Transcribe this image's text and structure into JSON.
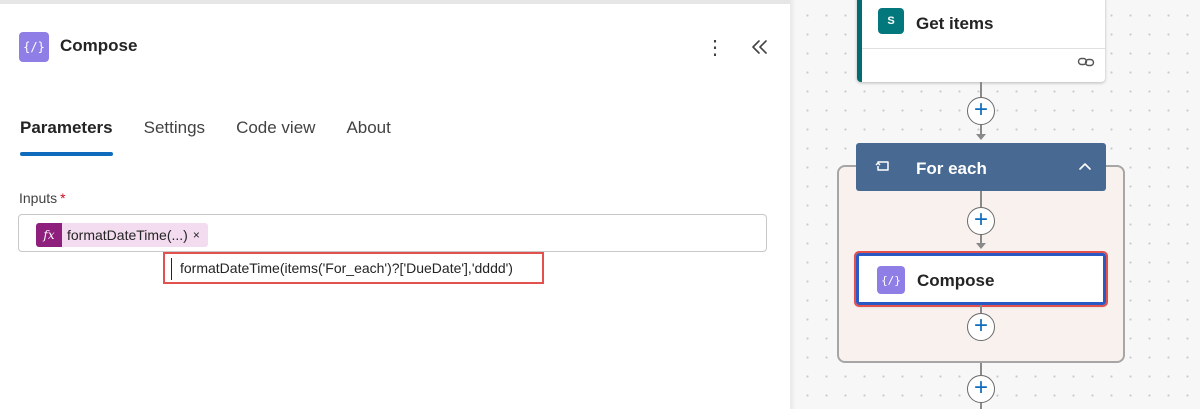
{
  "panel": {
    "icon": "compose-icon",
    "icon_glyph": "{/}",
    "title": "Compose",
    "more_glyph": "⋮",
    "tabs": [
      {
        "label": "Parameters",
        "active": true
      },
      {
        "label": "Settings",
        "active": false
      },
      {
        "label": "Code view",
        "active": false
      },
      {
        "label": "About",
        "active": false
      }
    ],
    "inputs": {
      "label": "Inputs",
      "required_mark": "*",
      "token": {
        "fx_glyph": "fx",
        "label": "formatDateTime(...)",
        "remove_glyph": "×"
      },
      "expression": "formatDateTime(items('For_each')?['DueDate'],'dddd')"
    }
  },
  "canvas": {
    "get_items": {
      "icon_glyph": "S",
      "title": "Get items"
    },
    "for_each": {
      "title": "For each"
    },
    "compose": {
      "icon_glyph": "{/}",
      "title": "Compose"
    },
    "plus_glyph": "+"
  },
  "colors": {
    "accent": "#0f6cbd",
    "compose_purple": "#8f7ee6",
    "foreach_header": "#486991",
    "sharepoint_teal": "#036c70",
    "highlight_red": "#e3514f"
  }
}
